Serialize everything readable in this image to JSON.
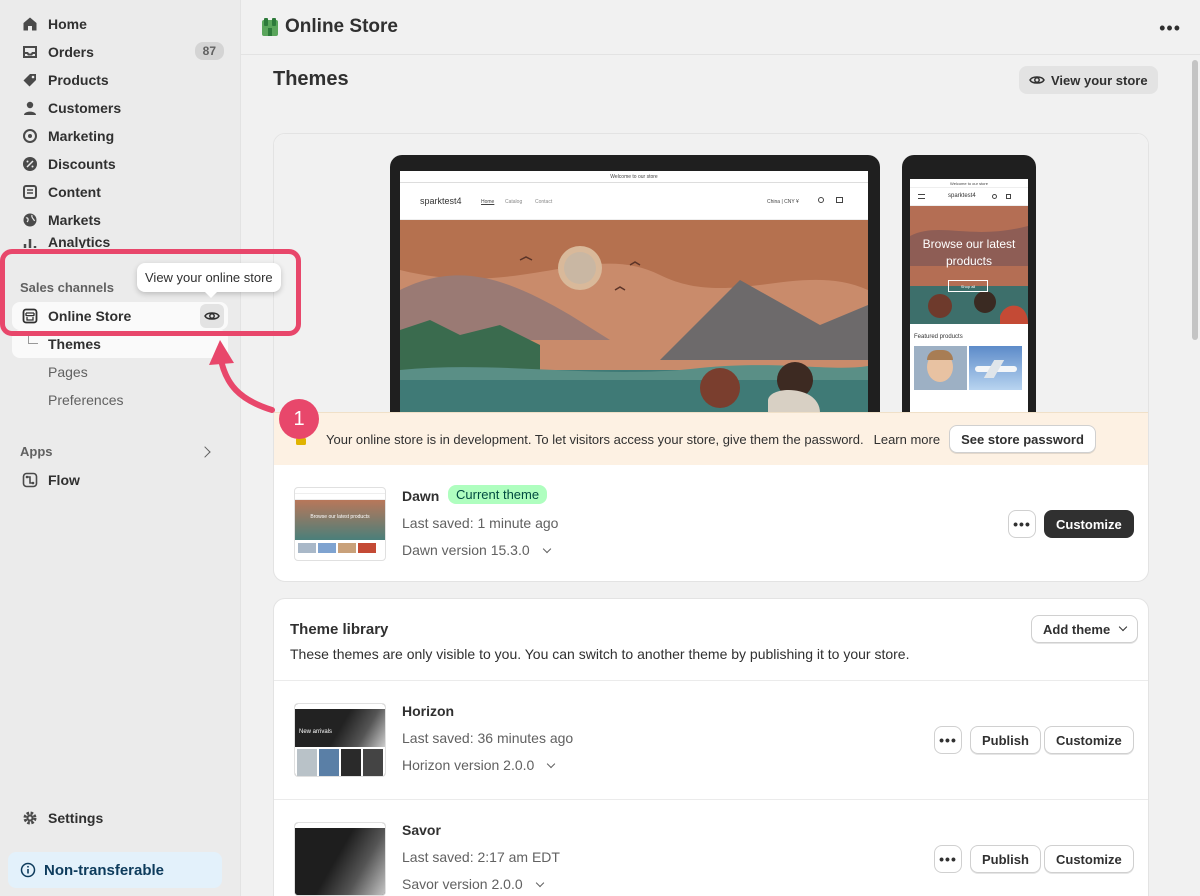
{
  "sidebar": {
    "items": [
      {
        "label": "Home",
        "icon": "home-icon"
      },
      {
        "label": "Orders",
        "icon": "orders-icon",
        "count": "87"
      },
      {
        "label": "Products",
        "icon": "tag-icon"
      },
      {
        "label": "Customers",
        "icon": "person-icon"
      },
      {
        "label": "Marketing",
        "icon": "target-icon"
      },
      {
        "label": "Discounts",
        "icon": "discount-icon"
      },
      {
        "label": "Content",
        "icon": "content-icon"
      },
      {
        "label": "Markets",
        "icon": "globe-icon"
      },
      {
        "label": "Analytics",
        "icon": "chart-icon"
      }
    ],
    "sales_channels_label": "Sales channels",
    "online_store_label": "Online Store",
    "sub_items": [
      "Themes",
      "Pages",
      "Preferences"
    ],
    "apps_label": "Apps",
    "flow_label": "Flow",
    "settings_label": "Settings",
    "non_transferable_label": "Non-transferable",
    "tooltip": "View your online store"
  },
  "step_number": "1",
  "topbar": {
    "title": "Online Store"
  },
  "page": {
    "title": "Themes",
    "view_store_label": "View your store"
  },
  "preview": {
    "announcement": "Welcome to our store",
    "store_name": "sparktest4",
    "nav": [
      "Home",
      "Catalog",
      "Contact"
    ],
    "currency": "China | CNY ¥",
    "mobile_headline": "Browse our latest products",
    "mobile_shop_all": "Shop all",
    "featured_label": "Featured products"
  },
  "banner": {
    "text": "Your online store is in development. To let visitors access your store, give them the password.",
    "link": "Learn more",
    "button": "See store password"
  },
  "current_theme": {
    "name": "Dawn",
    "badge": "Current theme",
    "saved": "Last saved: 1 minute ago",
    "version": "Dawn version 15.3.0",
    "customize_label": "Customize",
    "thumb_headline": "Browse our latest products"
  },
  "library": {
    "title": "Theme library",
    "description": "These themes are only visible to you. You can switch to another theme by publishing it to your store.",
    "add_theme_label": "Add theme",
    "themes": [
      {
        "name": "Horizon",
        "saved": "Last saved: 36 minutes ago",
        "version": "Horizon version 2.0.0",
        "thumb_headline": "New arrivals"
      },
      {
        "name": "Savor",
        "saved": "Last saved: 2:17 am EDT",
        "version": "Savor version 2.0.0"
      }
    ],
    "publish_label": "Publish",
    "customize_label": "Customize"
  },
  "colors": {
    "accent": "#e8476b",
    "badge_green": "#affebf",
    "banner_bg": "#fdf1e3"
  }
}
